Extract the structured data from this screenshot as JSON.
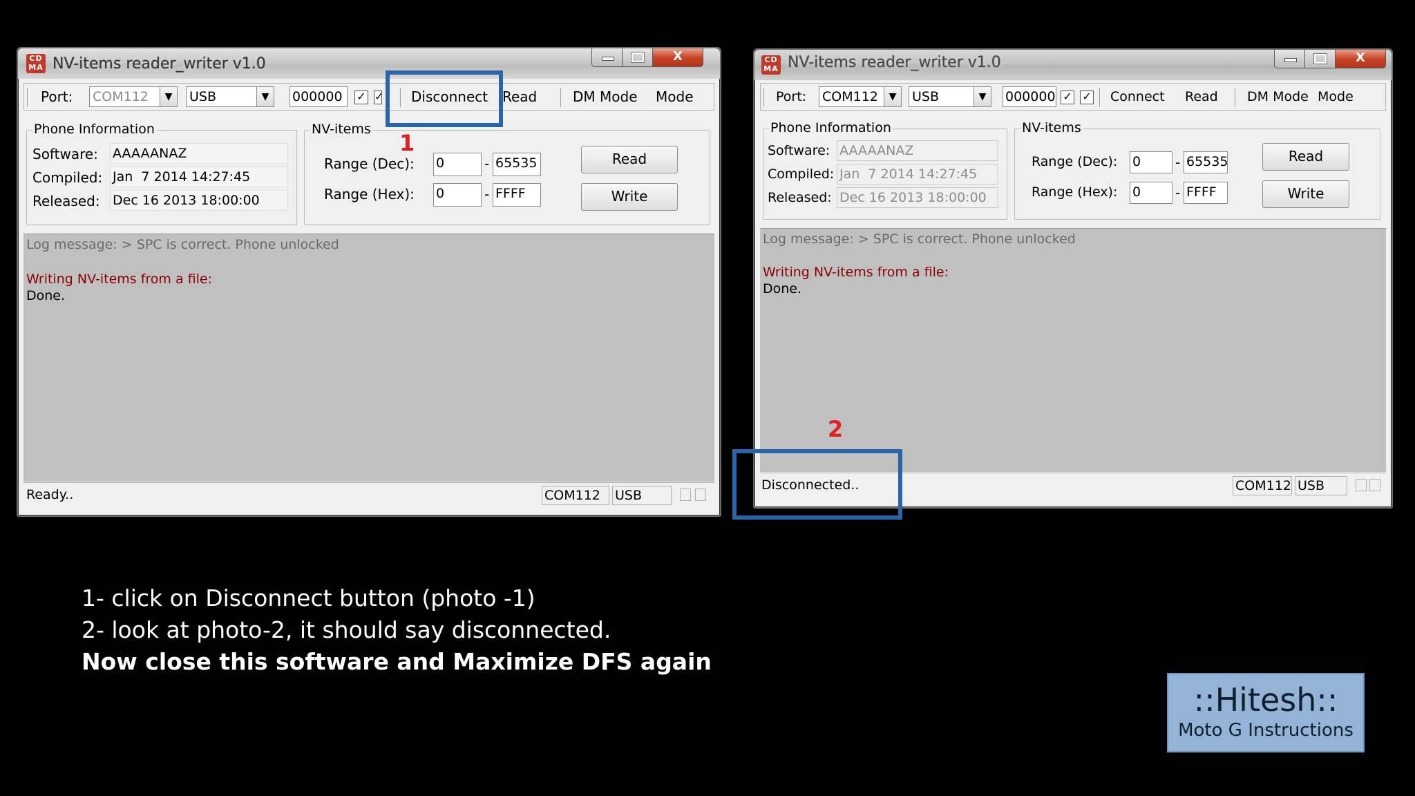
{
  "window_title": "NV-items reader_writer v1.0",
  "app_icon_text": "CD MA",
  "close_symbol": "X",
  "toolbar": {
    "port_label": "Port:",
    "port_value": "COM112",
    "conn_value": "USB",
    "spc_value": "000000",
    "check_mark": "✓",
    "disconnect_label": "Disconnect",
    "connect_label": "Connect",
    "read_label": "Read",
    "dm_mode_label": "DM Mode",
    "mode_label": "Mode"
  },
  "phone_info": {
    "legend": "Phone Information",
    "software_label": "Software:",
    "software_value": "AAAAANAZ",
    "compiled_label": "Compiled:",
    "compiled_value": "Jan  7 2014 14:27:45",
    "released_label": "Released:",
    "released_value": "Dec 16 2013 18:00:00"
  },
  "nv_items": {
    "legend": "NV-items",
    "range_dec_label": "Range (Dec):",
    "range_dec_from": "0",
    "range_dec_to": "65535",
    "range_hex_label": "Range (Hex):",
    "range_hex_from": "0",
    "range_hex_to": "FFFF",
    "dash": "-",
    "read_button": "Read",
    "write_button": "Write"
  },
  "log": {
    "header": "Log message: >   SPC is correct. Phone unlocked",
    "line1": "Writing NV-items from a file:",
    "line2": "Done."
  },
  "status_left": {
    "text": "Ready..",
    "port": "COM112",
    "conn": "USB"
  },
  "status_right": {
    "text": "Disconnected..",
    "port": "COM112",
    "conn": "USB"
  },
  "markers": {
    "one": "1",
    "two": "2"
  },
  "instructions": {
    "line1": "1- click on Disconnect button (photo -1)",
    "line2": "2- look at photo-2, it should say disconnected.",
    "line3": "Now close this software and Maximize DFS again"
  },
  "badge": {
    "name": "::Hitesh::",
    "subtitle": "Moto G Instructions"
  },
  "colors": {
    "highlight": "#2a65a8",
    "marker": "#e02020",
    "log_red": "#8b0000",
    "badge_bg": "#95b3d7"
  }
}
